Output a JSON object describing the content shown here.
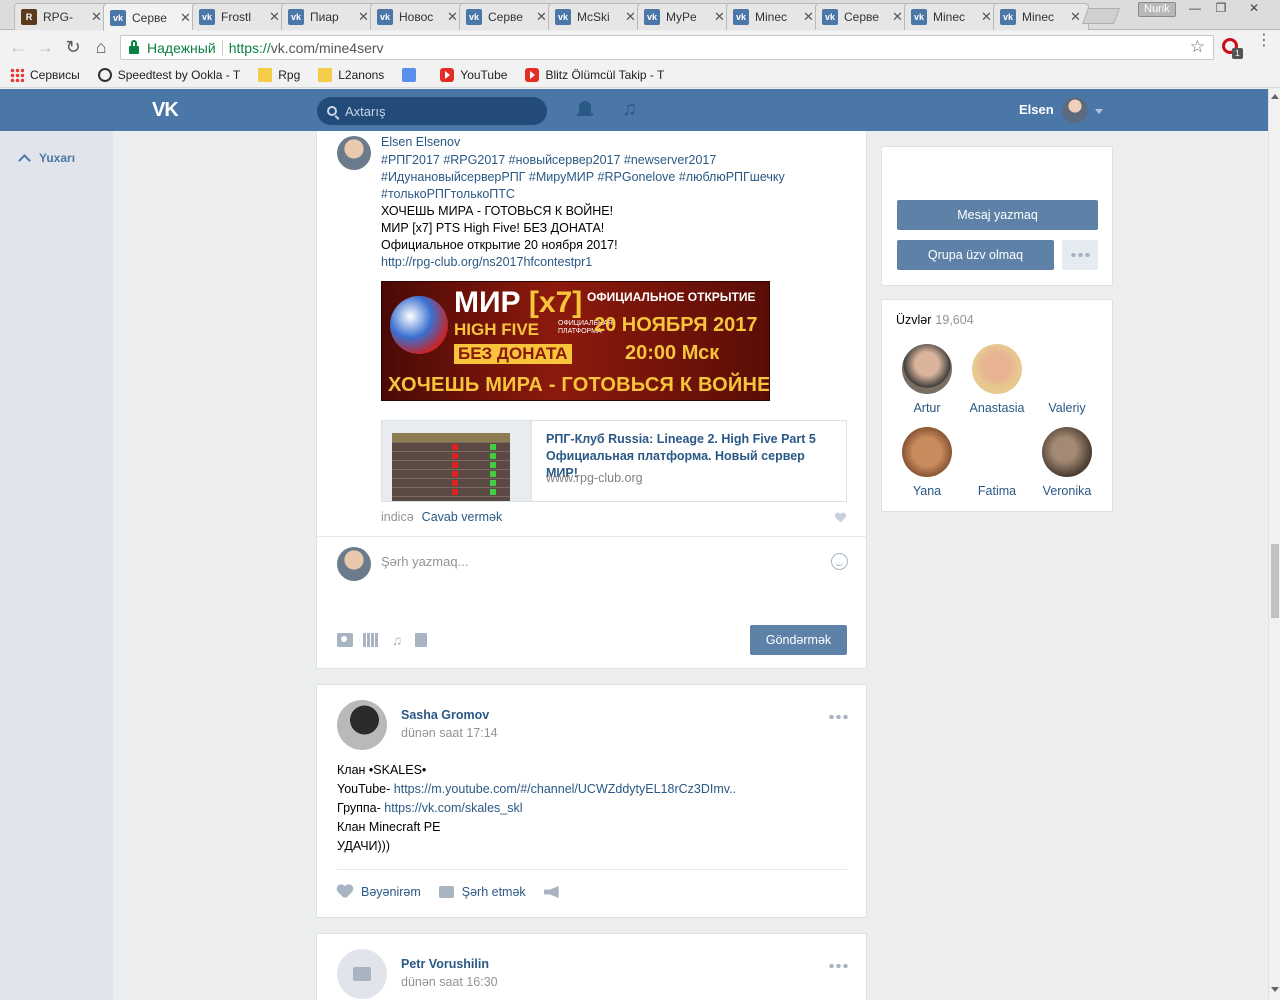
{
  "browser": {
    "tabs": [
      {
        "label": "RPG-",
        "favicon": "rpg-club-favicon"
      },
      {
        "label": "Серве",
        "favicon": "vk-favicon",
        "active": true
      },
      {
        "label": "Frostl",
        "favicon": "vk-favicon"
      },
      {
        "label": "Пиар",
        "favicon": "vk-favicon"
      },
      {
        "label": "Новос",
        "favicon": "vk-favicon"
      },
      {
        "label": "Серве",
        "favicon": "vk-favicon"
      },
      {
        "label": "McSki",
        "favicon": "vk-favicon"
      },
      {
        "label": "MyPe",
        "favicon": "vk-favicon"
      },
      {
        "label": "Minec",
        "favicon": "vk-favicon"
      },
      {
        "label": "Серве",
        "favicon": "vk-favicon"
      },
      {
        "label": "Minec",
        "favicon": "vk-favicon"
      },
      {
        "label": "Minec",
        "favicon": "vk-favicon"
      }
    ],
    "profile_name": "Nurik",
    "secure_label": "Надежный",
    "url_proto": "https://",
    "url_rest": "vk.com/mine4serv",
    "extension_badge": "1",
    "bookmarks": [
      {
        "label": "Сервисы",
        "icon": "apps-grid-icon"
      },
      {
        "label": "Speedtest by Ookla - T",
        "icon": "speedometer-icon"
      },
      {
        "label": "Rpg",
        "icon": "folder-icon"
      },
      {
        "label": "L2anons",
        "icon": "folder-icon"
      },
      {
        "label": "",
        "icon": "translate-icon"
      },
      {
        "label": "YouTube",
        "icon": "youtube-icon"
      },
      {
        "label": "Blitz Ölümcül Takip - T",
        "icon": "youtube-icon"
      }
    ]
  },
  "vk": {
    "logo": "VK",
    "search_placeholder": "Axtarış",
    "user_name": "Elsen",
    "up_link": "Yuxarı"
  },
  "comment_post": {
    "author": "Elsen Elsenov",
    "lines": [
      "#РПГ2017 #RPG2017 #новыйсервер2017 #newserver2017",
      "#ИдунановыйсерверРПГ #МируМИР #RPGonelove #люблюРПГшечку",
      "#толькоРПГтолькоПТС",
      "ХОЧЕШЬ МИРА - ГОТОВЬСЯ К ВОЙНЕ!",
      "МИР [x7] PTS High Five! БЕЗ ДОНАТА!",
      "Официальное открытие 20 ноября 2017!"
    ],
    "url": "http://rpg-club.org/ns2017hfcontestpr1",
    "banner": {
      "title": "МИР",
      "rate": "[x7]",
      "chronicle": "HIGH FIVE",
      "platform": "ОФИЦИАЛЬНАЯ ПЛАТФОРМА",
      "no_donate": "БЕЗ ДОНАТА",
      "opening": "ОФИЦИАЛЬНОЕ ОТКРЫТИЕ",
      "date": "20 НОЯБРЯ 2017",
      "time": "20:00 Мск",
      "slogan": "ХОЧЕШЬ МИРА - ГОТОВЬСЯ К ВОЙНЕ"
    },
    "link": {
      "title": "РПГ-Клуб Russia: Lineage 2. High Five Part 5 Официальная платформа. Новый сервер МИР!",
      "domain": "www.rpg-club.org"
    },
    "time": "indicə",
    "reply": "Cavab vermək"
  },
  "comment_box": {
    "placeholder": "Şərh yazmaq...",
    "send": "Göndərmək"
  },
  "post2": {
    "author": "Sasha Gromov",
    "date": "dünən saat 17:14",
    "line1": "Клан •SKALES•",
    "youtube_prefix": "YouTube- ",
    "youtube_link": "https://m.youtube.com/#/channel/UCWZddytyEL18rCz3DImv..",
    "group_prefix": "Группа- ",
    "group_link": "https://vk.com/skales_skl",
    "line4": "Клан Minecraft PE",
    "line5": "УДАЧИ)))",
    "like": "Bəyənirəm",
    "comment": "Şərh etmək"
  },
  "post3": {
    "author": "Petr Vorushilin",
    "date": "dünən saat 16:30"
  },
  "sidebar": {
    "message_button": "Mesaj yazmaq",
    "join_button": "Qrupa üzv olmaq",
    "members_label": "Üzvlər",
    "members_count": "19,604",
    "members": [
      {
        "name": "Artur"
      },
      {
        "name": "Anastasia"
      },
      {
        "name": "Valeriy"
      },
      {
        "name": "Yana"
      },
      {
        "name": "Fatima"
      },
      {
        "name": "Veronika"
      }
    ]
  }
}
